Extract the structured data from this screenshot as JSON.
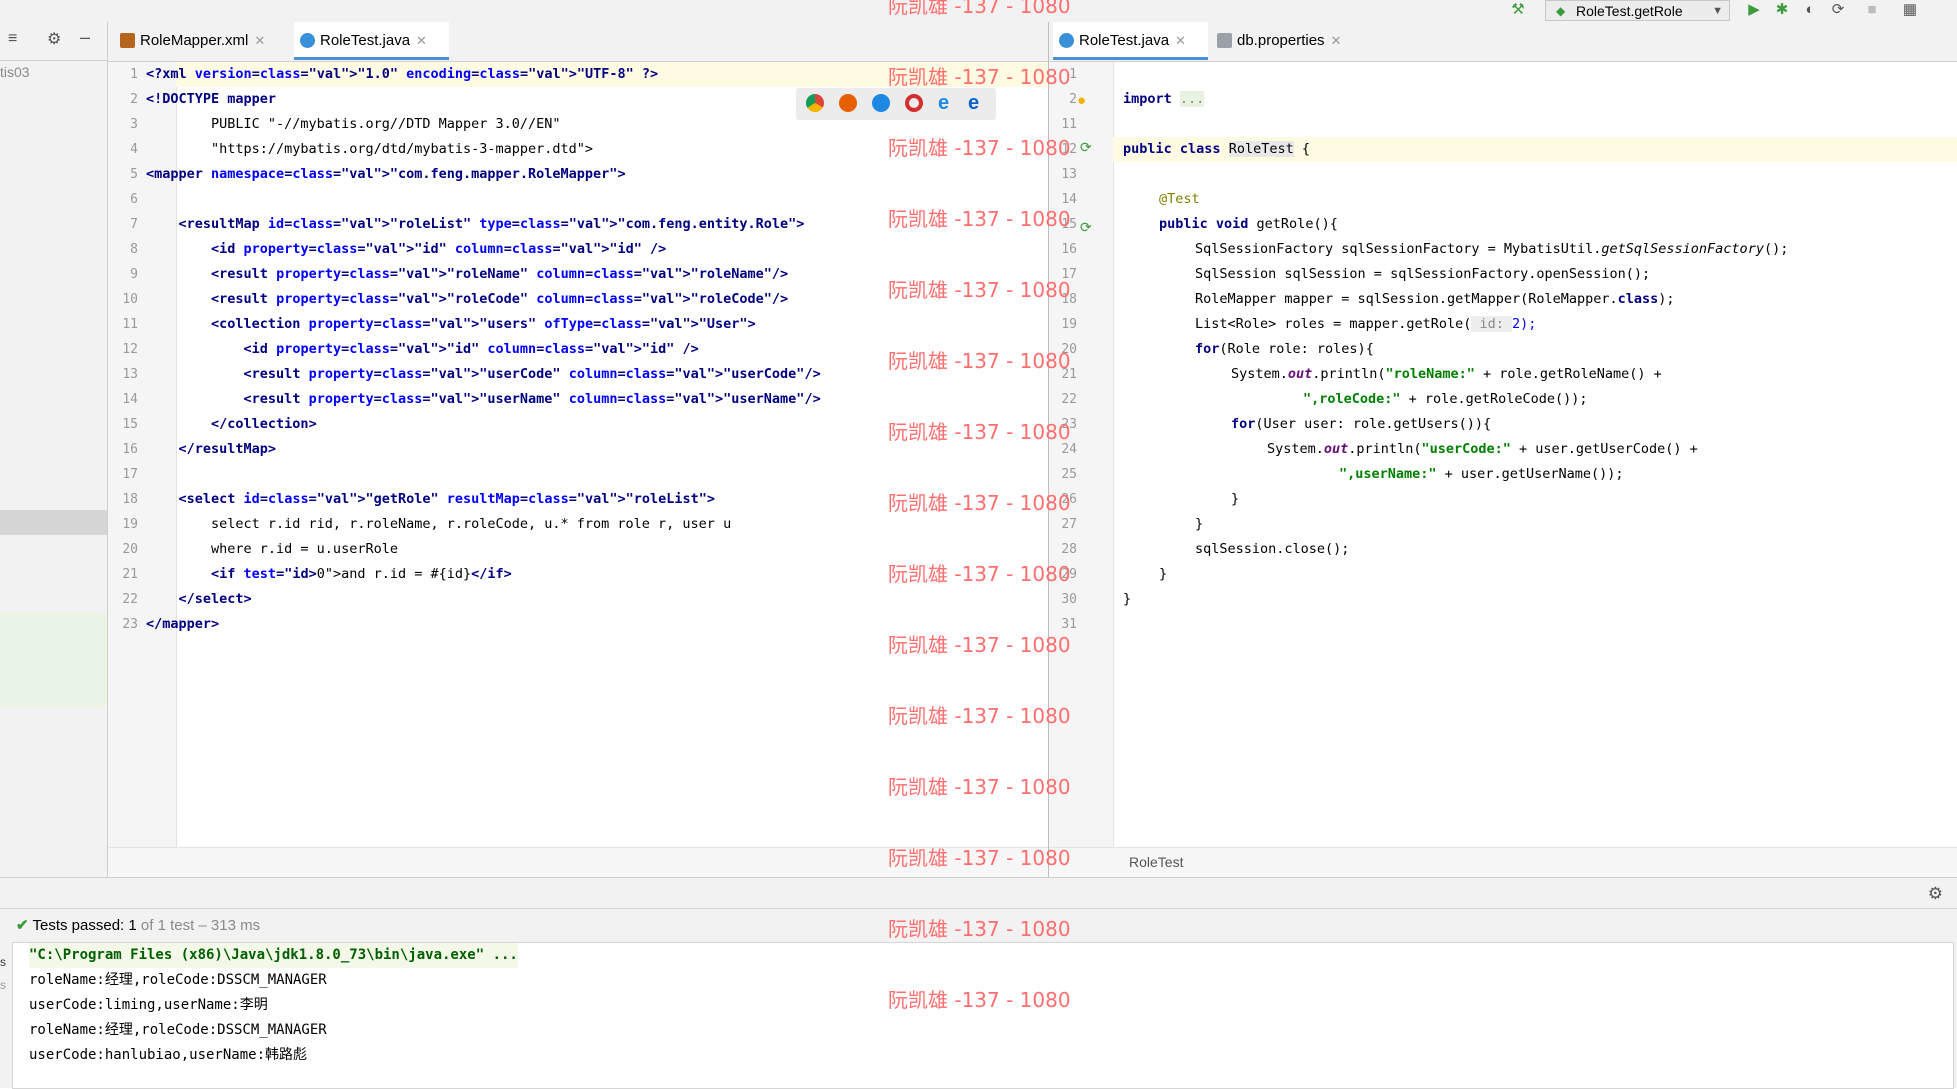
{
  "run_config": {
    "label": "RoleTest.getRole"
  },
  "left_panel": {
    "project_label": "tis03"
  },
  "left_editor": {
    "tabs": [
      {
        "label": "RoleMapper.xml"
      },
      {
        "label": "RoleTest.java"
      }
    ],
    "line_numbers": [
      "1",
      "2",
      "3",
      "4",
      "5",
      "6",
      "7",
      "8",
      "9",
      "10",
      "11",
      "12",
      "13",
      "14",
      "15",
      "16",
      "17",
      "18",
      "19",
      "20",
      "21",
      "22",
      "23"
    ],
    "lines": [
      "<?xml version=\"1.0\" encoding=\"UTF-8\" ?>",
      "<!DOCTYPE mapper",
      "        PUBLIC \"-//mybatis.org//DTD Mapper 3.0//EN\"",
      "        \"https://mybatis.org/dtd/mybatis-3-mapper.dtd\">",
      "<mapper namespace=\"com.feng.mapper.RoleMapper\">",
      "",
      "    <resultMap id=\"roleList\" type=\"com.feng.entity.Role\">",
      "        <id property=\"id\" column=\"id\" />",
      "        <result property=\"roleName\" column=\"roleName\"/>",
      "        <result property=\"roleCode\" column=\"roleCode\"/>",
      "        <collection property=\"users\" ofType=\"User\">",
      "            <id property=\"id\" column=\"id\" />",
      "            <result property=\"userCode\" column=\"userCode\"/>",
      "            <result property=\"userName\" column=\"userName\"/>",
      "        </collection>",
      "    </resultMap>",
      "",
      "    <select id=\"getRole\" resultMap=\"roleList\">",
      "        select r.id rid, r.roleName, r.roleCode, u.* from role r, user u",
      "        where r.id = u.userRole",
      "        <if test=\"id>0\">and r.id = #{id}</if>",
      "    </select>",
      "</mapper>"
    ]
  },
  "right_editor": {
    "tabs": [
      {
        "label": "RoleTest.java"
      },
      {
        "label": "db.properties"
      }
    ],
    "line_numbers": [
      "1",
      "2",
      "11",
      "12",
      "13",
      "14",
      "15",
      "16",
      "17",
      "18",
      "19",
      "20",
      "21",
      "22",
      "23",
      "24",
      "25",
      "26",
      "27",
      "28",
      "29",
      "30",
      "31"
    ],
    "code": {
      "import_kw": "import",
      "import_fold": "...",
      "class_kw": "public class",
      "class_name": "RoleTest",
      "class_brace": "{",
      "annotation": "@Test",
      "method_kw": "public void",
      "method_sig": "getRole(){",
      "l16a": "SqlSessionFactory sqlSessionFactory = MybatisUtil.",
      "l16b": "getSqlSessionFactory",
      "l16c": "();",
      "l17": "SqlSession sqlSession = sqlSessionFactory.openSession();",
      "l18a": "RoleMapper mapper = sqlSession.getMapper(RoleMapper.",
      "l18b": "class",
      "l18c": ");",
      "l19a": "List<Role> roles = mapper.getRole(",
      "l19hint": " id: ",
      "l19b": "2);",
      "l20kw": "for",
      "l20": "(Role role: roles){",
      "l21a": "System.",
      "l21b": "out",
      "l21c": ".println(",
      "l21s": "\"roleName:\"",
      "l21d": " + role.getRoleName() +",
      "l22s": "\",roleCode:\"",
      "l22d": " + role.getRoleCode());",
      "l23kw": "for",
      "l23": "(User user: role.getUsers()){",
      "l24a": "System.",
      "l24b": "out",
      "l24c": ".println(",
      "l24s": "\"userCode:\"",
      "l24d": " + user.getUserCode() +",
      "l25s": "\",userName:\"",
      "l25d": " + user.getUserName());",
      "l26": "}",
      "l27": "}",
      "l28": "sqlSession.close();",
      "l29": "}",
      "l30": "}"
    },
    "breadcrumb": "RoleTest"
  },
  "test_results": {
    "passed_label": "Tests passed:",
    "count": "1",
    "detail": "of 1 test – 313 ms"
  },
  "console": {
    "lines": [
      "\"C:\\Program Files (x86)\\Java\\jdk1.8.0_73\\bin\\java.exe\" ...",
      "roleName:经理,roleCode:DSSCM_MANAGER",
      "userCode:liming,userName:李明",
      "roleName:经理,roleCode:DSSCM_MANAGER",
      "userCode:hanlubiao,userName:韩路彪"
    ]
  },
  "watermark": {
    "text": "阮凯雄 -137 - 1080"
  },
  "colors": {
    "accent": "#4a90d9",
    "tag": "#000080",
    "attr": "#0000ff",
    "value": "#008000",
    "watermark": "#ff6e6e",
    "pass": "#3c9b3c"
  }
}
